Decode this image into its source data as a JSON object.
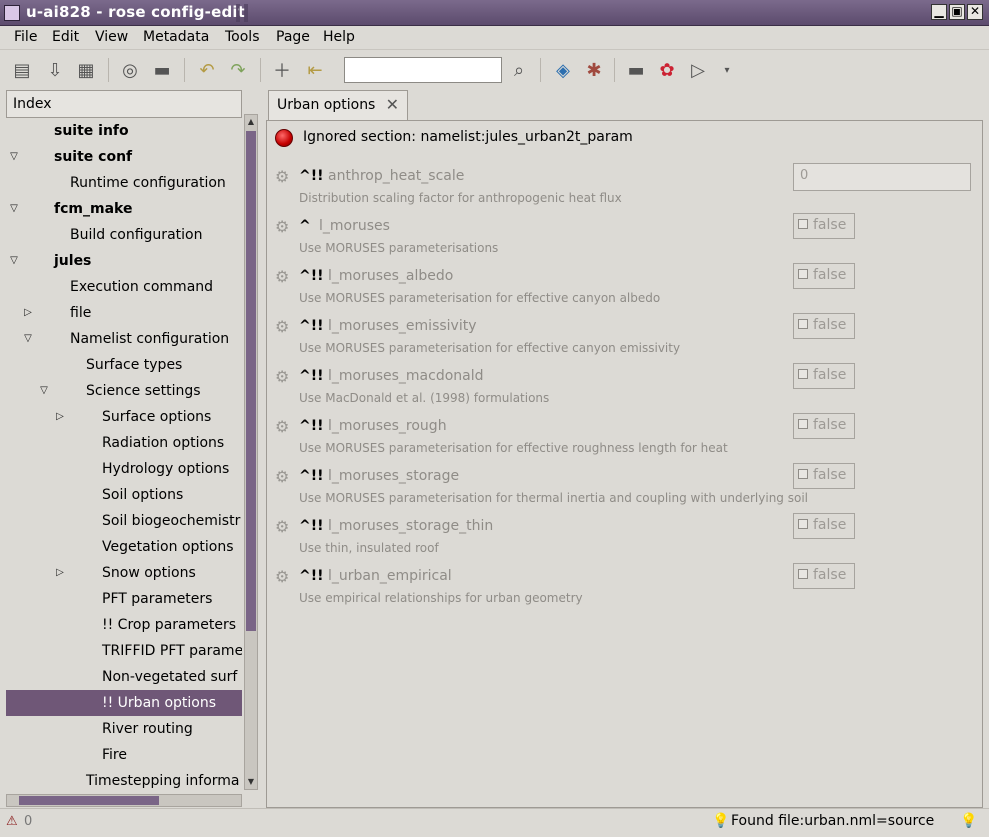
{
  "window": {
    "title": "u-ai828 - rose config-edit"
  },
  "menu": [
    "File",
    "Edit",
    "View",
    "Metadata",
    "Tools",
    "Page",
    "Help"
  ],
  "search": {
    "value": ""
  },
  "index": {
    "header": "Index",
    "items": [
      {
        "label": "suite info",
        "bold": true,
        "arrow": ""
      },
      {
        "label": "suite conf",
        "bold": true,
        "arrow": "▽"
      },
      {
        "label": "Runtime configuration",
        "bold": false,
        "arrow": ""
      },
      {
        "label": "fcm_make",
        "bold": true,
        "arrow": "▽"
      },
      {
        "label": "Build configuration",
        "bold": false,
        "arrow": ""
      },
      {
        "label": "jules",
        "bold": true,
        "arrow": "▽"
      },
      {
        "label": "Execution command",
        "bold": false,
        "arrow": ""
      },
      {
        "label": "file",
        "bold": false,
        "arrow": "▷"
      },
      {
        "label": "Namelist configuration",
        "bold": false,
        "arrow": "▽"
      },
      {
        "label": "Surface types",
        "bold": false,
        "arrow": ""
      },
      {
        "label": "Science settings",
        "bold": false,
        "arrow": "▽"
      },
      {
        "label": "Surface options",
        "bold": false,
        "arrow": "▷"
      },
      {
        "label": "Radiation options",
        "bold": false,
        "arrow": ""
      },
      {
        "label": "Hydrology options",
        "bold": false,
        "arrow": ""
      },
      {
        "label": "Soil options",
        "bold": false,
        "arrow": ""
      },
      {
        "label": "Soil biogeochemistr",
        "bold": false,
        "arrow": ""
      },
      {
        "label": "Vegetation options",
        "bold": false,
        "arrow": ""
      },
      {
        "label": "Snow options",
        "bold": false,
        "arrow": "▷"
      },
      {
        "label": "PFT parameters",
        "bold": false,
        "arrow": ""
      },
      {
        "label": "!! Crop parameters",
        "bold": false,
        "arrow": ""
      },
      {
        "label": "TRIFFID PFT parame",
        "bold": false,
        "arrow": ""
      },
      {
        "label": "Non-vegetated surf",
        "bold": false,
        "arrow": ""
      },
      {
        "label": "!! Urban options",
        "bold": false,
        "arrow": "",
        "selected": true
      },
      {
        "label": "River routing",
        "bold": false,
        "arrow": ""
      },
      {
        "label": "Fire",
        "bold": false,
        "arrow": ""
      },
      {
        "label": "Timestepping informa",
        "bold": false,
        "arrow": ""
      }
    ]
  },
  "tab": {
    "label": "Urban options",
    "close": "✕"
  },
  "section": {
    "status": "Ignored section: namelist:jules_urban2t_param"
  },
  "options": [
    {
      "flags": "^!!",
      "name": "anthrop_heat_scale",
      "desc": "Distribution scaling factor for anthropogenic heat flux",
      "value": "0",
      "kind": "text"
    },
    {
      "flags": "^",
      "name": "l_moruses",
      "desc": "Use MORUSES parameterisations",
      "value": "false",
      "kind": "bool"
    },
    {
      "flags": "^!!",
      "name": "l_moruses_albedo",
      "desc": "Use MORUSES parameterisation for effective canyon albedo",
      "value": "false",
      "kind": "bool"
    },
    {
      "flags": "^!!",
      "name": "l_moruses_emissivity",
      "desc": "Use MORUSES parameterisation for effective canyon emissivity",
      "value": "false",
      "kind": "bool"
    },
    {
      "flags": "^!!",
      "name": "l_moruses_macdonald",
      "desc": "Use MacDonald et al. (1998) formulations",
      "value": "false",
      "kind": "bool"
    },
    {
      "flags": "^!!",
      "name": "l_moruses_rough",
      "desc": "Use MORUSES parameterisation for effective roughness length for heat",
      "value": "false",
      "kind": "bool"
    },
    {
      "flags": "^!!",
      "name": "l_moruses_storage",
      "desc": "Use MORUSES parameterisation for thermal inertia and coupling with underlying soil",
      "value": "false",
      "kind": "bool"
    },
    {
      "flags": "^!!",
      "name": "l_moruses_storage_thin",
      "desc": "Use thin, insulated roof",
      "value": "false",
      "kind": "bool"
    },
    {
      "flags": "^!!",
      "name": "l_urban_empirical",
      "desc": "Use empirical relationships for urban geometry",
      "value": "false",
      "kind": "bool"
    }
  ],
  "status": {
    "warning_count": "0",
    "message": "Found file:urban.nml=source"
  }
}
